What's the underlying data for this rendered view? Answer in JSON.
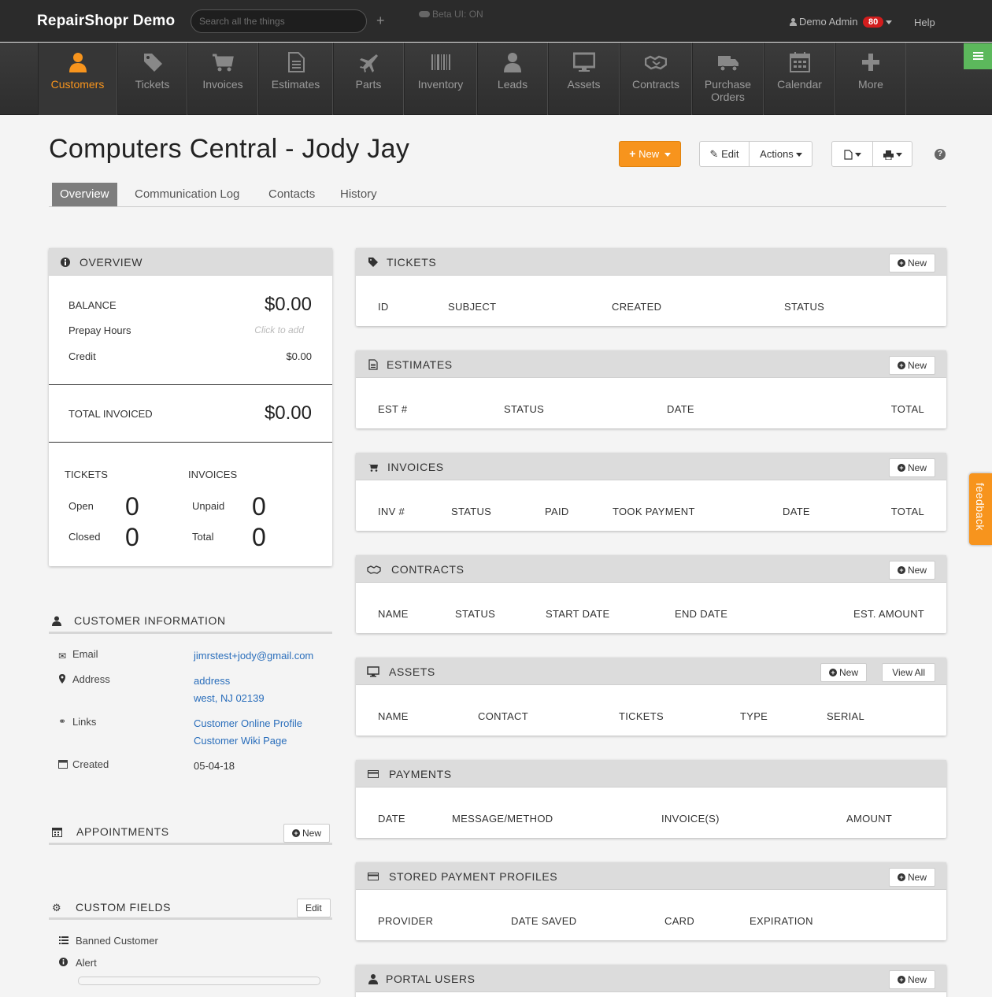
{
  "header": {
    "brand": "RepairShopr Demo",
    "search_placeholder": "Search all the things",
    "beta_label": "Beta UI: ON",
    "user_name": "Demo Admin",
    "notification_count": "80",
    "help_label": "Help"
  },
  "nav": {
    "items": [
      {
        "label": "Customers",
        "icon": "user-icon"
      },
      {
        "label": "Tickets",
        "icon": "tag-icon"
      },
      {
        "label": "Invoices",
        "icon": "cart-icon"
      },
      {
        "label": "Estimates",
        "icon": "document-icon"
      },
      {
        "label": "Parts",
        "icon": "plane-icon"
      },
      {
        "label": "Inventory",
        "icon": "barcode-icon"
      },
      {
        "label": "Leads",
        "icon": "person-icon"
      },
      {
        "label": "Assets",
        "icon": "monitor-icon"
      },
      {
        "label": "Contracts",
        "icon": "handshake-icon"
      },
      {
        "label": "Purchase",
        "label2": "Orders",
        "icon": "truck-icon"
      },
      {
        "label": "Calendar",
        "icon": "calendar-icon"
      },
      {
        "label": "More",
        "icon": "plus-icon"
      }
    ],
    "active_color": "#f7941d"
  },
  "page": {
    "title": "Computers Central - Jody Jay",
    "new_button": "New",
    "edit_button": "Edit",
    "actions_button": "Actions",
    "tabs": [
      "Overview",
      "Communication Log",
      "Contacts",
      "History"
    ]
  },
  "overview": {
    "title": "OVERVIEW",
    "balance_label": "BALANCE",
    "balance_value": "$0.00",
    "prepay_label": "Prepay Hours",
    "prepay_placeholder": "Click to add",
    "credit_label": "Credit",
    "credit_value": "$0.00",
    "total_invoiced_label": "TOTAL INVOICED",
    "total_invoiced_value": "$0.00",
    "tickets_label": "TICKETS",
    "invoices_label": "INVOICES",
    "open_label": "Open",
    "open_value": "0",
    "closed_label": "Closed",
    "closed_value": "0",
    "unpaid_label": "Unpaid",
    "unpaid_value": "0",
    "total_label": "Total",
    "total_value": "0"
  },
  "customer_info": {
    "title": "CUSTOMER INFORMATION",
    "email_label": "Email",
    "email_value": "jimrstest+jody@gmail.com",
    "address_label": "Address",
    "address_line1": "address",
    "address_line2": "west, NJ 02139",
    "links_label": "Links",
    "link1": "Customer Online Profile",
    "link2": "Customer Wiki Page",
    "created_label": "Created",
    "created_value": "05-04-18"
  },
  "appointments": {
    "title": "APPOINTMENTS",
    "new_label": "New"
  },
  "custom_fields": {
    "title": "CUSTOM FIELDS",
    "edit_label": "Edit",
    "banned_label": "Banned Customer",
    "alert_label": "Alert"
  },
  "panels": {
    "new_label": "New",
    "view_all_label": "View All",
    "tickets": {
      "title": "TICKETS",
      "cols": [
        "ID",
        "SUBJECT",
        "CREATED",
        "STATUS"
      ]
    },
    "estimates": {
      "title": "ESTIMATES",
      "cols": [
        "EST #",
        "STATUS",
        "DATE",
        "TOTAL"
      ]
    },
    "invoices": {
      "title": "INVOICES",
      "cols": [
        "INV #",
        "STATUS",
        "PAID",
        "TOOK PAYMENT",
        "DATE",
        "TOTAL"
      ]
    },
    "contracts": {
      "title": "CONTRACTS",
      "cols": [
        "NAME",
        "STATUS",
        "START DATE",
        "END DATE",
        "EST. AMOUNT"
      ]
    },
    "assets": {
      "title": "ASSETS",
      "cols": [
        "NAME",
        "CONTACT",
        "TICKETS",
        "TYPE",
        "SERIAL"
      ]
    },
    "payments": {
      "title": "PAYMENTS",
      "cols": [
        "DATE",
        "MESSAGE/METHOD",
        "INVOICE(S)",
        "AMOUNT"
      ]
    },
    "stored_profiles": {
      "title": "STORED PAYMENT PROFILES",
      "cols": [
        "PROVIDER",
        "DATE SAVED",
        "CARD",
        "EXPIRATION"
      ]
    },
    "portal_users": {
      "title": "PORTAL USERS"
    }
  },
  "feedback_label": "feedback"
}
